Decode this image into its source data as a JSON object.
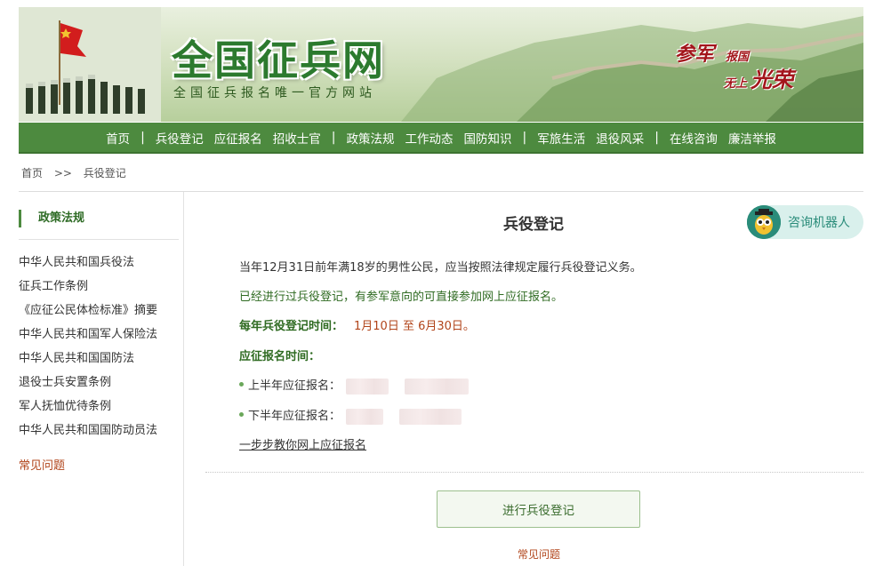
{
  "banner": {
    "logo_title": "全国征兵网",
    "logo_subtitle": "全国征兵报名唯一官方网站",
    "slogan": [
      "参军",
      "报国",
      "无上",
      "光荣"
    ]
  },
  "nav": {
    "items": [
      "首页",
      "兵役登记",
      "应征报名",
      "招收士官",
      "政策法规",
      "工作动态",
      "国防知识",
      "军旅生活",
      "退役风采",
      "在线咨询",
      "廉洁举报"
    ],
    "separator": "|"
  },
  "breadcrumb": {
    "home": "首页",
    "arrow": ">>",
    "current": "兵役登记"
  },
  "sidebar": {
    "title": "政策法规",
    "items": [
      "中华人民共和国兵役法",
      "征兵工作条例",
      "《应征公民体检标准》摘要",
      "中华人民共和国军人保险法",
      "中华人民共和国国防法",
      "退役士兵安置条例",
      "军人抚恤优待条例",
      "中华人民共和国国防动员法"
    ],
    "faq": "常见问题"
  },
  "main": {
    "title": "兵役登记",
    "robot_label": "咨询机器人",
    "line1": "当年12月31日前年满18岁的男性公民，应当按照法律规定履行兵役登记义务。",
    "line2": "已经进行过兵役登记，有参军意向的可直接参加网上应征报名。",
    "reg_time_label": "每年兵役登记时间：",
    "reg_time_value": "1月10日 至 6月30日。",
    "apply_time_label": "应征报名时间：",
    "first_half_label": "上半年应征报名：",
    "second_half_label": "下半年应征报名：",
    "guide_link": "一步步教你网上应征报名",
    "register_button": "进行兵役登记",
    "faq": "常见问题"
  }
}
